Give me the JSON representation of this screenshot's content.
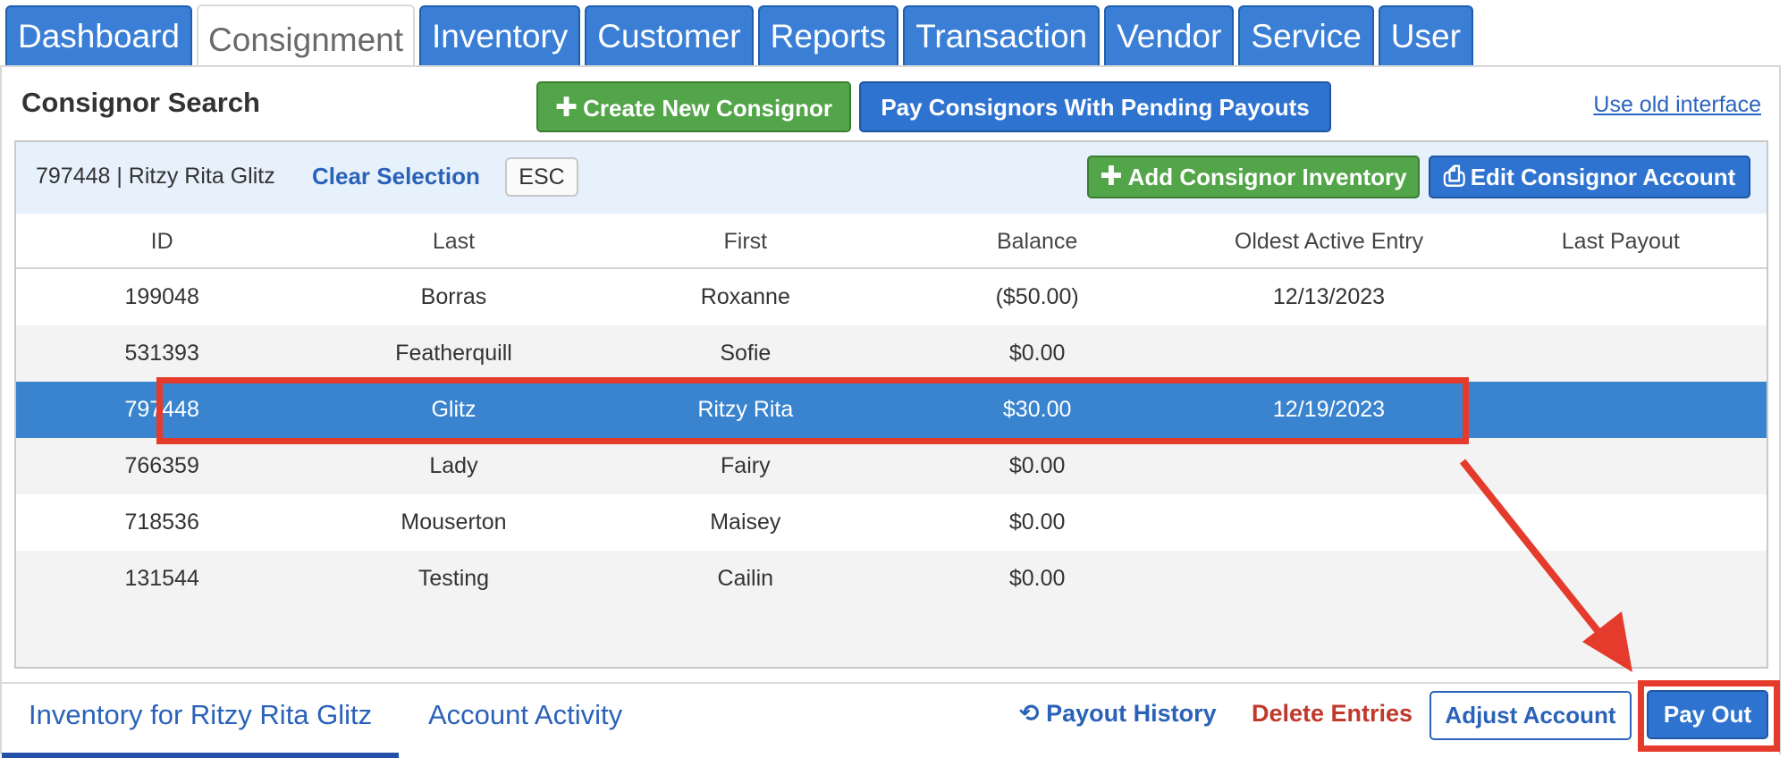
{
  "tabs": [
    {
      "label": "Dashboard"
    },
    {
      "label": "Consignment",
      "active": true
    },
    {
      "label": "Inventory"
    },
    {
      "label": "Customer"
    },
    {
      "label": "Reports"
    },
    {
      "label": "Transaction"
    },
    {
      "label": "Vendor"
    },
    {
      "label": "Service"
    },
    {
      "label": "User"
    }
  ],
  "header": {
    "title": "Consignor Search",
    "create_label": "Create New Consignor",
    "pay_pending_label": "Pay Consignors With Pending Payouts",
    "old_interface_label": "Use old interface"
  },
  "selection": {
    "text": "797448 | Ritzy Rita Glitz",
    "clear_label": "Clear Selection",
    "esc_label": "ESC",
    "add_inventory_label": "Add Consignor Inventory",
    "edit_account_label": "Edit Consignor Account"
  },
  "table": {
    "columns": [
      "ID",
      "Last",
      "First",
      "Balance",
      "Oldest Active Entry",
      "Last Payout"
    ],
    "rows": [
      {
        "id": "199048",
        "last": "Borras",
        "first": "Roxanne",
        "balance": "($50.00)",
        "oldest": "12/13/2023",
        "last_payout": ""
      },
      {
        "id": "531393",
        "last": "Featherquill",
        "first": "Sofie",
        "balance": "$0.00",
        "oldest": "",
        "last_payout": ""
      },
      {
        "id": "797448",
        "last": "Glitz",
        "first": "Ritzy Rita",
        "balance": "$30.00",
        "oldest": "12/19/2023",
        "last_payout": "",
        "selected": true
      },
      {
        "id": "766359",
        "last": "Lady",
        "first": "Fairy",
        "balance": "$0.00",
        "oldest": "",
        "last_payout": ""
      },
      {
        "id": "718536",
        "last": "Mouserton",
        "first": "Maisey",
        "balance": "$0.00",
        "oldest": "",
        "last_payout": ""
      },
      {
        "id": "131544",
        "last": "Testing",
        "first": "Cailin",
        "balance": "$0.00",
        "oldest": "",
        "last_payout": ""
      }
    ]
  },
  "bottom": {
    "inventory_tab": "Inventory for Ritzy Rita Glitz",
    "activity_tab": "Account Activity",
    "payout_history_label": "Payout History",
    "delete_entries_label": "Delete Entries",
    "adjust_account_label": "Adjust Account",
    "pay_out_label": "Pay Out"
  },
  "colors": {
    "tab_blue": "#3a7fd5",
    "green_button": "#53a549",
    "blue_button": "#2f73d0",
    "selected_row": "#3a84cf",
    "link_blue": "#2a62b9",
    "delete_red": "#c0392b",
    "annotation_red": "#e53b2c"
  },
  "icons": {
    "create": "plus-icon",
    "add_inventory": "plus-icon",
    "edit_account": "printer-icon",
    "payout_history": "history-icon"
  }
}
